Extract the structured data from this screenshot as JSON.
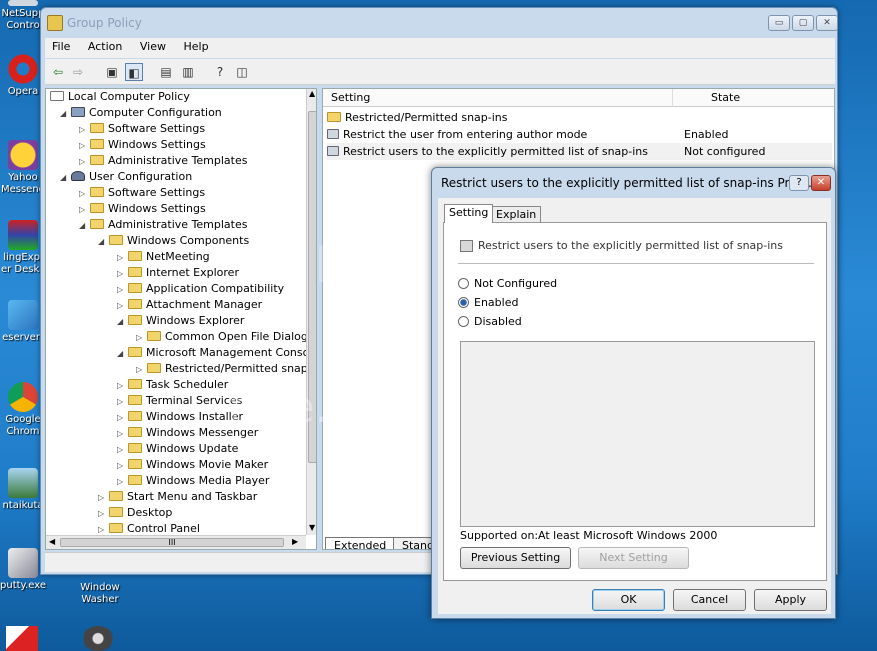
{
  "desktop": {
    "icons": [
      {
        "label": "NetSupp Contro",
        "name": "netsupport"
      },
      {
        "label": "Opera",
        "name": "opera"
      },
      {
        "label": "Yahoo Messeng",
        "name": "yahoo-messenger"
      },
      {
        "label": "lingExpl er DeskF",
        "name": "explorer-desk"
      },
      {
        "label": "eservert",
        "name": "eservert"
      },
      {
        "label": "Google Chrom",
        "name": "chrome"
      },
      {
        "label": "ntaikuta",
        "name": "ntaikuta"
      },
      {
        "label": "putty.exe",
        "name": "putty"
      },
      {
        "label": "Window Washer",
        "name": "window-washer"
      }
    ],
    "colors": {
      "background": "#1f7cc8"
    }
  },
  "window": {
    "title": "Group Policy",
    "controls": {
      "minimize": "▭",
      "maximize": "▢",
      "close": "✕"
    }
  },
  "menu": [
    "File",
    "Action",
    "View",
    "Help"
  ],
  "toolbar": {
    "icons": [
      "back-arrow-icon",
      "forward-arrow-icon",
      "up-folder-icon",
      "show-hide-tree-icon",
      "properties-icon",
      "export-list-icon",
      "help-icon",
      "console-tree-icon"
    ]
  },
  "tree": {
    "root": "Local Computer Policy",
    "items": [
      {
        "label": "Computer Configuration",
        "level": 1,
        "icon": "computer"
      },
      {
        "label": "Software Settings",
        "level": 2
      },
      {
        "label": "Windows Settings",
        "level": 2
      },
      {
        "label": "Administrative Templates",
        "level": 2
      },
      {
        "label": "User Configuration",
        "level": 1,
        "icon": "user"
      },
      {
        "label": "Software Settings",
        "level": 2
      },
      {
        "label": "Windows Settings",
        "level": 2
      },
      {
        "label": "Administrative Templates",
        "level": 2
      },
      {
        "label": "Windows Components",
        "level": 3
      },
      {
        "label": "NetMeeting",
        "level": 4
      },
      {
        "label": "Internet Explorer",
        "level": 4
      },
      {
        "label": "Application Compatibility",
        "level": 4
      },
      {
        "label": "Attachment Manager",
        "level": 4
      },
      {
        "label": "Windows Explorer",
        "level": 4
      },
      {
        "label": "Common Open File Dialog",
        "level": 5
      },
      {
        "label": "Microsoft Management Console",
        "level": 4
      },
      {
        "label": "Restricted/Permitted snap-in",
        "level": 5
      },
      {
        "label": "Task Scheduler",
        "level": 4
      },
      {
        "label": "Terminal Services",
        "level": 4
      },
      {
        "label": "Windows Installer",
        "level": 4
      },
      {
        "label": "Windows Messenger",
        "level": 4
      },
      {
        "label": "Windows Update",
        "level": 4
      },
      {
        "label": "Windows Movie Maker",
        "level": 4
      },
      {
        "label": "Windows Media Player",
        "level": 4
      },
      {
        "label": "Start Menu and Taskbar",
        "level": 3
      },
      {
        "label": "Desktop",
        "level": 3
      },
      {
        "label": "Control Panel",
        "level": 3
      }
    ],
    "hscroll_thumb": "III"
  },
  "list": {
    "headers": {
      "setting": "Setting",
      "state": "State"
    },
    "rows": [
      {
        "setting": "Restricted/Permitted snap-ins",
        "state": ""
      },
      {
        "setting": "Restrict the user from entering author mode",
        "state": "Enabled"
      },
      {
        "setting": "Restrict users to the explicitly permitted list of snap-ins",
        "state": "Not configured"
      }
    ],
    "tabs": [
      "Extended",
      "Standa"
    ]
  },
  "dialog": {
    "title": "Restrict users to the explicitly permitted list of snap-ins Prop...",
    "help": "?",
    "close": "✕",
    "tabs": [
      "Setting",
      "Explain"
    ],
    "policy_name": "Restrict users to the explicitly permitted list of snap-ins",
    "options": {
      "not_configured": "Not Configured",
      "enabled": "Enabled",
      "disabled": "Disabled"
    },
    "selected": "Enabled",
    "supported_label": "Supported on:",
    "supported_value": "At least Microsoft Windows 2000",
    "prev": "Previous Setting",
    "next": "Next Setting",
    "ok": "OK",
    "cancel": "Cancel",
    "apply": "Apply"
  },
  "watermark": {
    "brand": "photobucket",
    "slogan": "free. Share privately."
  }
}
